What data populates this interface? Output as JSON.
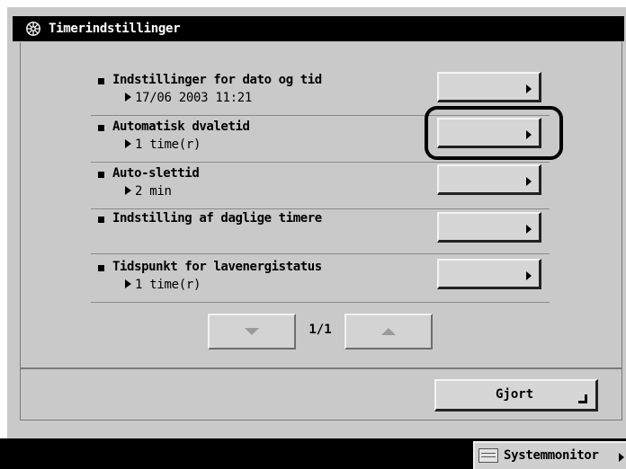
{
  "title": "Timerindstillinger",
  "settings": [
    {
      "label": "Indstillinger for dato og tid",
      "value": "17/06 2003 11:21"
    },
    {
      "label": "Automatisk dvaletid",
      "value": "1 time(r)"
    },
    {
      "label": "Auto-slettid",
      "value": "2 min"
    },
    {
      "label": "Indstilling af daglige timere",
      "value": ""
    },
    {
      "label": "Tidspunkt for lavenergistatus",
      "value": "1 time(r)"
    }
  ],
  "pagination": {
    "indicator": "1/1"
  },
  "done_label": "Gjort",
  "system_monitor_label": "Systemmonitor",
  "icons": {
    "title": "gear-icon",
    "page_down": "triangle-down-icon",
    "page_up": "triangle-up-icon"
  }
}
